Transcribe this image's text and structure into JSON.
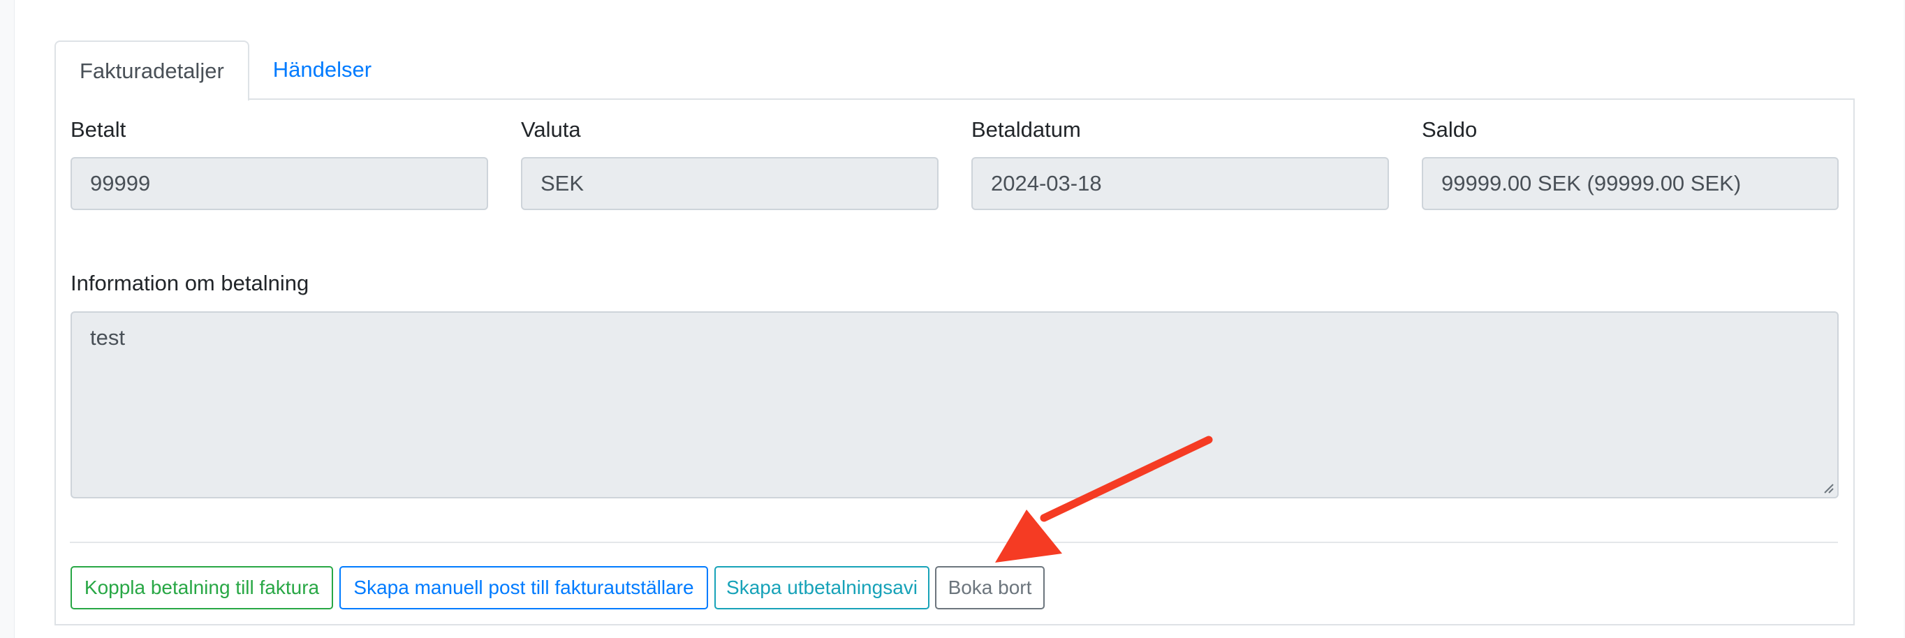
{
  "tabs": {
    "invoice_details": "Fakturadetaljer",
    "events": "Händelser"
  },
  "fields": {
    "paid": {
      "label": "Betalt",
      "value": "99999"
    },
    "currency": {
      "label": "Valuta",
      "value": "SEK"
    },
    "payment_date": {
      "label": "Betaldatum",
      "value": "2024-03-18"
    },
    "balance": {
      "label": "Saldo",
      "value": "99999.00 SEK (99999.00 SEK)"
    }
  },
  "payment_info": {
    "label": "Information om betalning",
    "value": "test"
  },
  "actions": {
    "link_payment": "Koppla betalning till faktura",
    "create_manual_entry": "Skapa manuell post till fakturautställare",
    "create_payout_notice": "Skapa utbetalningsavi",
    "write_off": "Boka bort"
  },
  "annotation": {
    "arrow_color": "#f53b23"
  },
  "colors": {
    "tab_link": "#007bff",
    "success": "#28a745",
    "primary": "#007bff",
    "info": "#17a2b8",
    "secondary": "#6c757d",
    "readonly_bg": "#e9ecef"
  }
}
